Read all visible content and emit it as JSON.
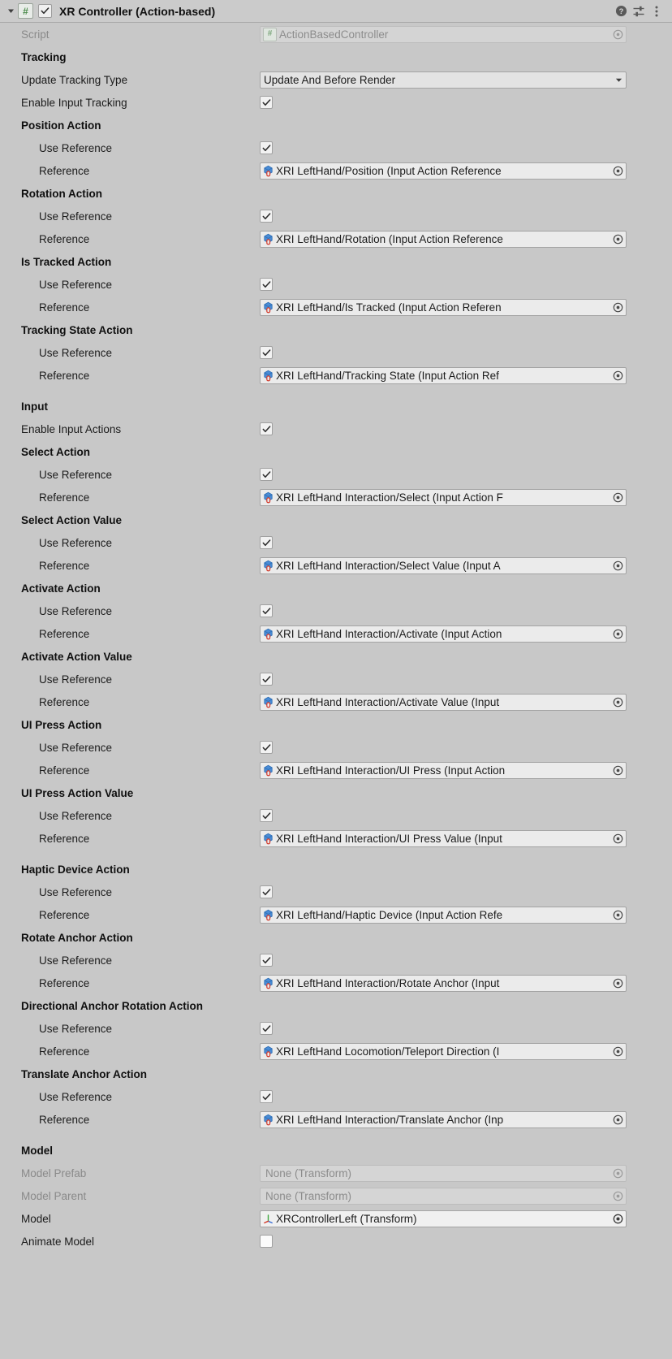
{
  "header": {
    "title": "XR Controller (Action-based)",
    "script_badge": "#",
    "enabled": true,
    "icons": {
      "foldout": "triangle-down-icon",
      "help": "help-icon",
      "preset": "preset-icon",
      "menu": "kebab-menu-icon"
    }
  },
  "script_row": {
    "label": "Script",
    "badge": "#",
    "value": "ActionBasedController"
  },
  "tracking": {
    "section": "Tracking",
    "update_tracking_type": {
      "label": "Update Tracking Type",
      "value": "Update And Before Render"
    },
    "enable_input_tracking": {
      "label": "Enable Input Tracking",
      "checked": true
    },
    "groups": [
      {
        "title": "Position Action",
        "use_reference_label": "Use Reference",
        "use_reference_checked": true,
        "reference_label": "Reference",
        "reference_value": "XRI LeftHand/Position (Input Action Reference"
      },
      {
        "title": "Rotation Action",
        "use_reference_label": "Use Reference",
        "use_reference_checked": true,
        "reference_label": "Reference",
        "reference_value": "XRI LeftHand/Rotation (Input Action Reference"
      },
      {
        "title": "Is Tracked Action",
        "use_reference_label": "Use Reference",
        "use_reference_checked": true,
        "reference_label": "Reference",
        "reference_value": "XRI LeftHand/Is Tracked (Input Action Referen"
      },
      {
        "title": "Tracking State Action",
        "use_reference_label": "Use Reference",
        "use_reference_checked": true,
        "reference_label": "Reference",
        "reference_value": "XRI LeftHand/Tracking State (Input Action Ref"
      }
    ]
  },
  "input": {
    "section": "Input",
    "enable_input_actions": {
      "label": "Enable Input Actions",
      "checked": true
    },
    "groups": [
      {
        "title": "Select Action",
        "use_reference_label": "Use Reference",
        "use_reference_checked": true,
        "reference_label": "Reference",
        "reference_value": "XRI LeftHand Interaction/Select (Input Action F"
      },
      {
        "title": "Select Action Value",
        "use_reference_label": "Use Reference",
        "use_reference_checked": true,
        "reference_label": "Reference",
        "reference_value": "XRI LeftHand Interaction/Select Value (Input A"
      },
      {
        "title": "Activate Action",
        "use_reference_label": "Use Reference",
        "use_reference_checked": true,
        "reference_label": "Reference",
        "reference_value": "XRI LeftHand Interaction/Activate (Input Action"
      },
      {
        "title": "Activate Action Value",
        "use_reference_label": "Use Reference",
        "use_reference_checked": true,
        "reference_label": "Reference",
        "reference_value": "XRI LeftHand Interaction/Activate Value (Input"
      },
      {
        "title": "UI Press Action",
        "use_reference_label": "Use Reference",
        "use_reference_checked": true,
        "reference_label": "Reference",
        "reference_value": "XRI LeftHand Interaction/UI Press (Input Action"
      },
      {
        "title": "UI Press Action Value",
        "use_reference_label": "Use Reference",
        "use_reference_checked": true,
        "reference_label": "Reference",
        "reference_value": "XRI LeftHand Interaction/UI Press Value (Input"
      },
      {
        "title": "Haptic Device Action",
        "use_reference_label": "Use Reference",
        "use_reference_checked": true,
        "reference_label": "Reference",
        "reference_value": "XRI LeftHand/Haptic Device (Input Action Refe"
      },
      {
        "title": "Rotate Anchor Action",
        "use_reference_label": "Use Reference",
        "use_reference_checked": true,
        "reference_label": "Reference",
        "reference_value": "XRI LeftHand Interaction/Rotate Anchor (Input"
      },
      {
        "title": "Directional Anchor Rotation Action",
        "use_reference_label": "Use Reference",
        "use_reference_checked": true,
        "reference_label": "Reference",
        "reference_value": "XRI LeftHand Locomotion/Teleport Direction (I"
      },
      {
        "title": "Translate Anchor Action",
        "use_reference_label": "Use Reference",
        "use_reference_checked": true,
        "reference_label": "Reference",
        "reference_value": "XRI LeftHand Interaction/Translate Anchor (Inp"
      }
    ]
  },
  "model": {
    "section": "Model",
    "model_prefab": {
      "label": "Model Prefab",
      "value": "None (Transform)",
      "disabled": true
    },
    "model_parent": {
      "label": "Model Parent",
      "value": "None (Transform)",
      "disabled": true
    },
    "model": {
      "label": "Model",
      "value": "XRControllerLeft (Transform)",
      "icon": "transform-axis-icon"
    },
    "animate_model": {
      "label": "Animate Model",
      "checked": false
    }
  },
  "colors": {
    "background": "#c8c8c8",
    "header_bg": "#cbcbcb",
    "field_bg": "#ebebeb",
    "field_disabled_bg": "#d5d5d5",
    "text": "#1c1c1c",
    "text_dim": "#8a8a8a",
    "script_green": "#4a8a4a",
    "ref_icon_blue": "#3d7fd4",
    "ref_icon_red": "#d43b2f"
  }
}
